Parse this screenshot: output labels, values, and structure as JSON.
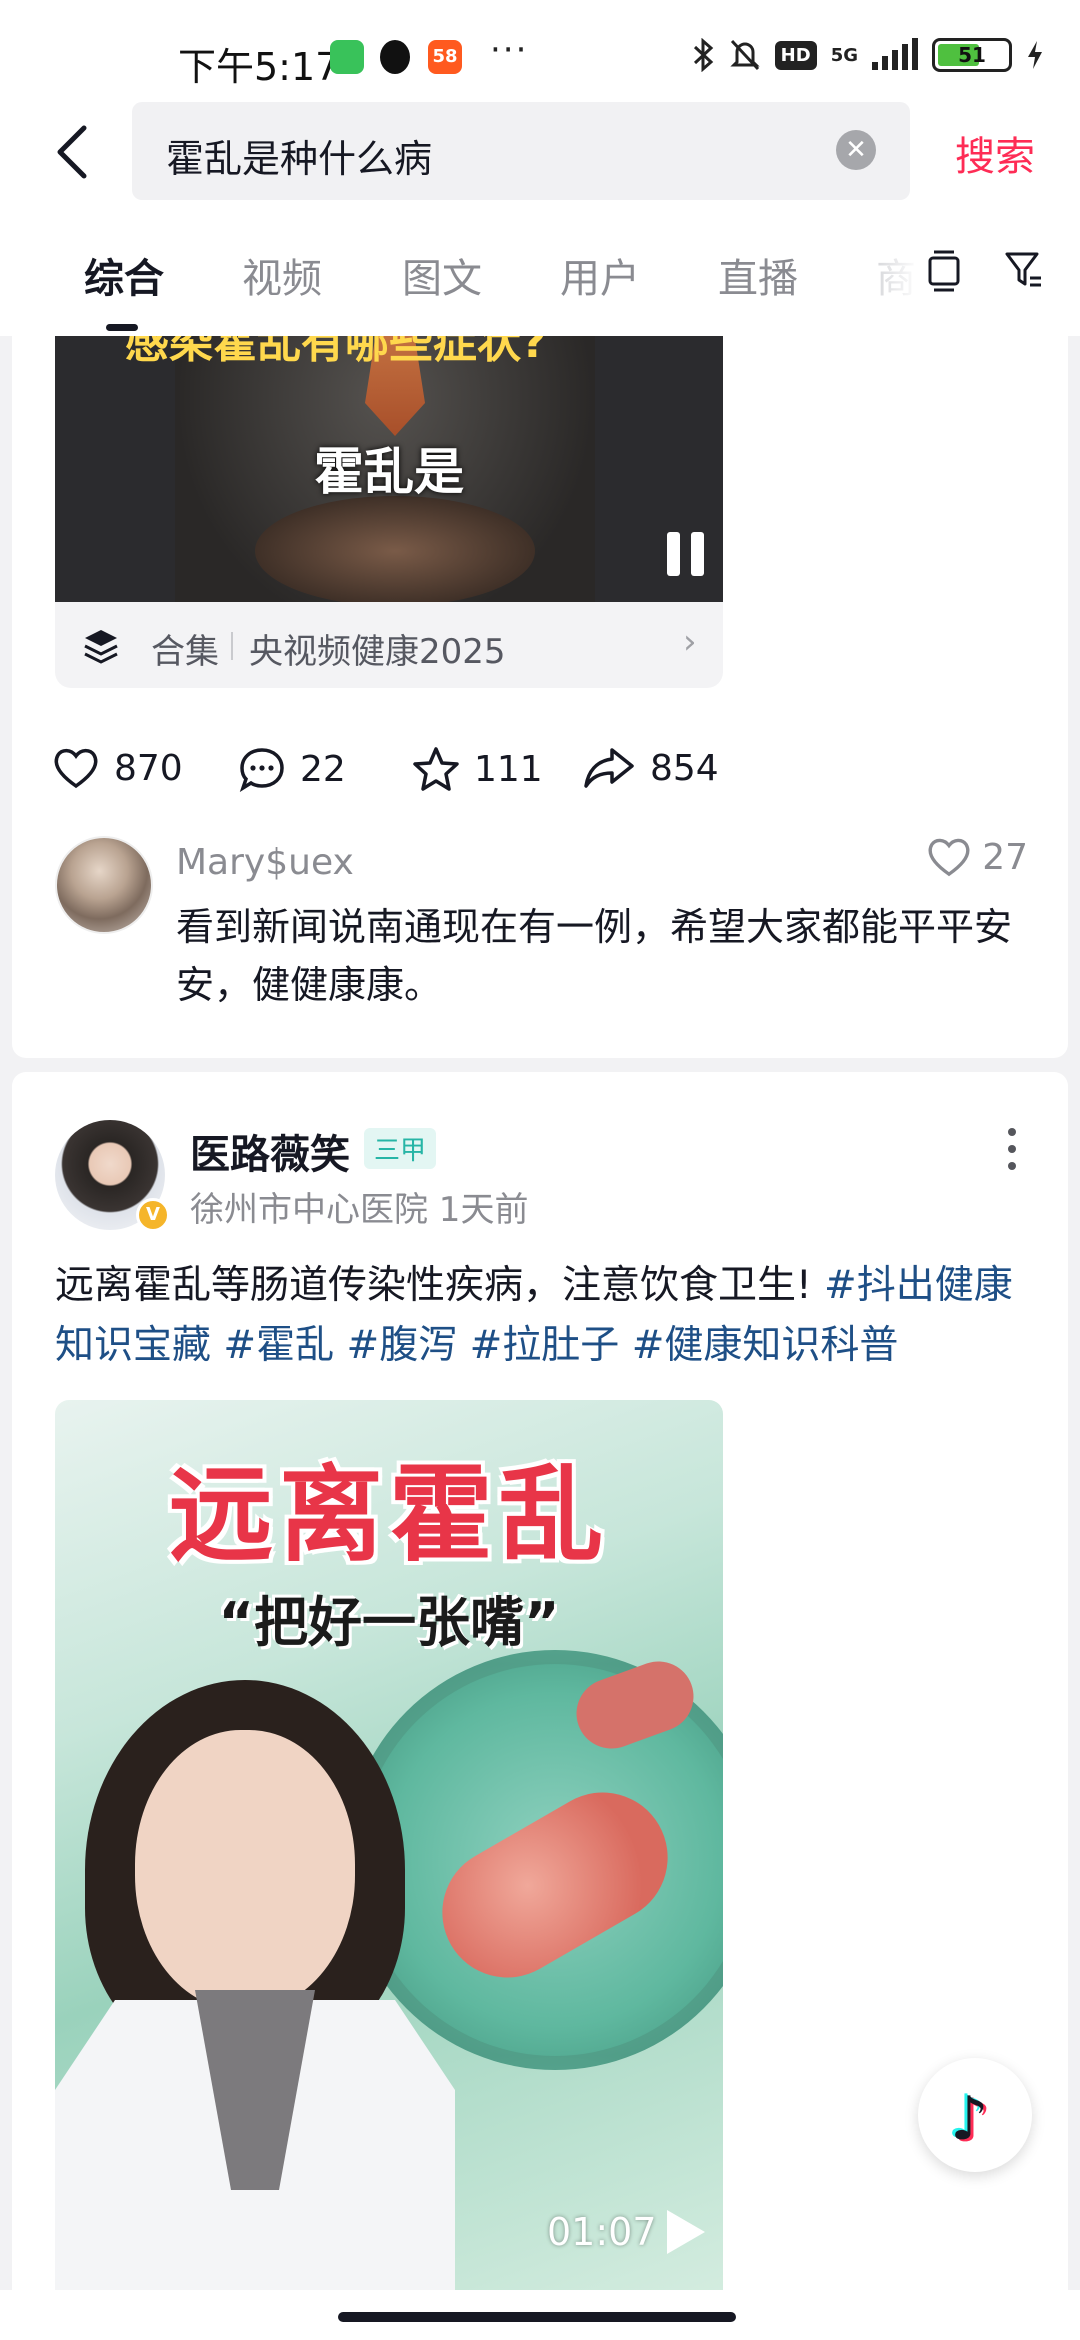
{
  "status_bar": {
    "time": "下午5:17",
    "network": "5G",
    "hd": "HD",
    "battery": "51",
    "more": "···",
    "icons": [
      "wechat-icon",
      "qq-icon",
      "58-app-icon",
      "bluetooth-icon",
      "silent-icon",
      "signal-icon",
      "charging-icon"
    ]
  },
  "search": {
    "query": "霍乱是种什么病",
    "button_label": "搜索"
  },
  "tabs": [
    {
      "label": "综合",
      "active": true
    },
    {
      "label": "视频"
    },
    {
      "label": "图文"
    },
    {
      "label": "用户"
    },
    {
      "label": "直播"
    },
    {
      "label": "商"
    }
  ],
  "post1": {
    "video_caption": "霍乱是",
    "video_banner": "感染霍乱有哪些症状?",
    "collection_label": "合集",
    "collection_name": "央视频健康2025",
    "likes": "870",
    "comments": "22",
    "favorites": "111",
    "shares": "854",
    "top_comment": {
      "user": "Mary$uex",
      "likes": "27",
      "text": "看到新闻说南通现在有一例，希望大家都能平平安安，健健康康。"
    }
  },
  "post2": {
    "author": "医路薇笑",
    "badge": "三甲",
    "verified": "V",
    "meta": "徐州市中心医院 1天前",
    "text": "远离霍乱等肠道传染性疾病，注意饮食卫生! ",
    "hashtags": [
      "#抖出健康知识宝藏",
      "#霍乱",
      "#腹泻",
      "#拉肚子",
      "#健康知识科普"
    ],
    "cover_title": "远离霍乱",
    "cover_subtitle": "“把好一张嘴”",
    "duration": "01:07"
  },
  "colors": {
    "accent": "#fe2c55",
    "hashtag": "#1e4f86",
    "badge": "#27b5a6",
    "text_primary": "#161823",
    "text_secondary": "#8a8b91"
  }
}
